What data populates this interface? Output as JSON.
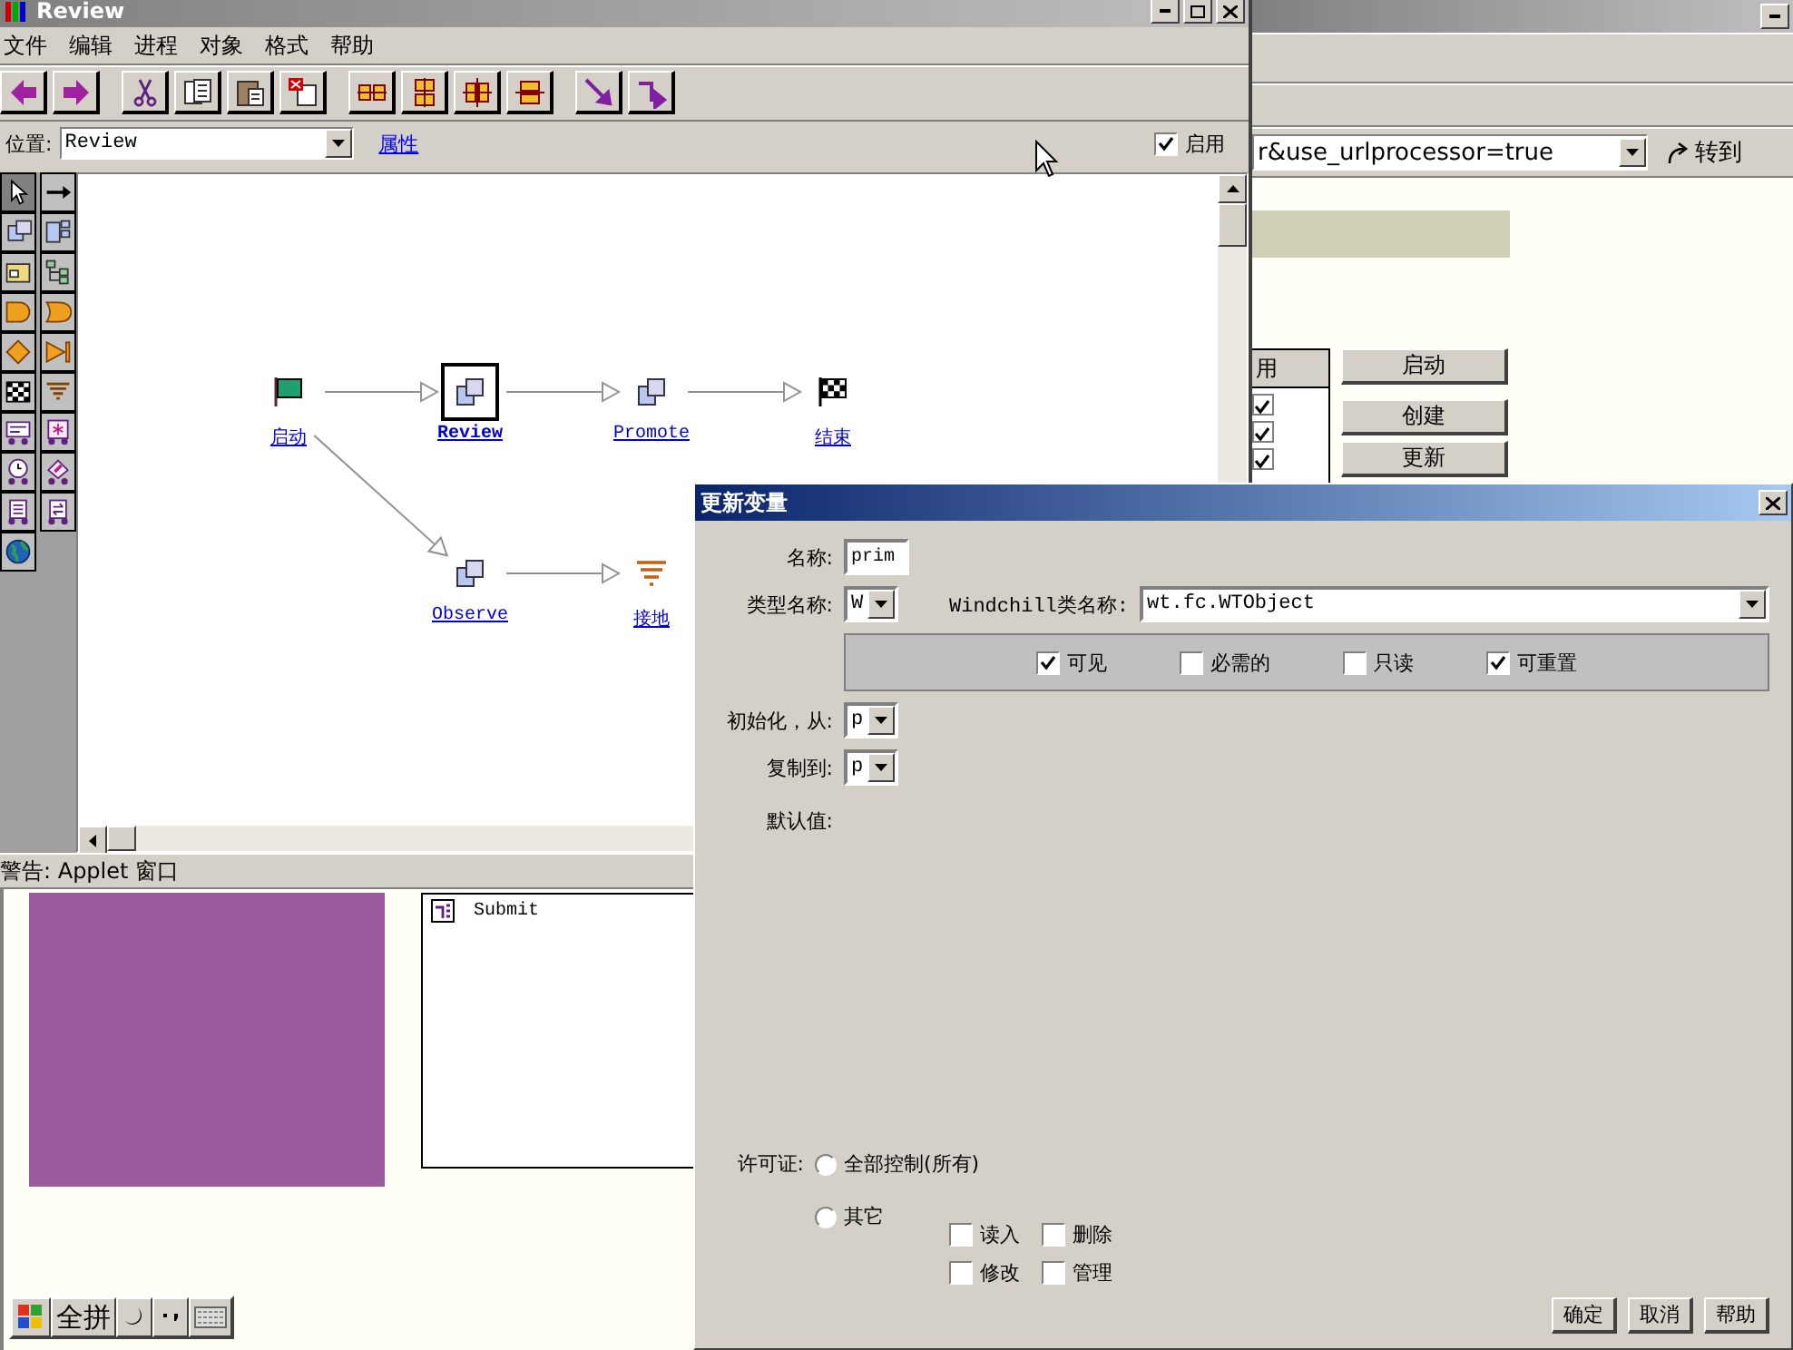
{
  "browser_window": {
    "address": "r&use_urlprocessor=true",
    "go_button": "转到",
    "table_header": "用",
    "table_rows": [
      {
        "checked": true
      },
      {
        "checked": true
      },
      {
        "checked": true
      }
    ],
    "buttons": [
      "启动",
      "创建",
      "更新"
    ]
  },
  "editor_window": {
    "title": "Review",
    "menu": [
      "文件",
      "编辑",
      "进程",
      "对象",
      "格式",
      "帮助"
    ],
    "location_label": "位置:",
    "location_value": "Review",
    "properties_link": "属性",
    "enabled_label": "启用",
    "enabled_checked": true,
    "palette": [
      {
        "selected": true
      },
      {
        "selected": false
      },
      {
        "selected": false
      },
      {
        "selected": false
      },
      {
        "selected": false
      },
      {
        "selected": false
      },
      {
        "selected": false
      },
      {
        "selected": false
      },
      {
        "selected": false
      },
      {
        "selected": false
      },
      {
        "selected": false
      },
      {
        "selected": false
      },
      {
        "selected": false
      },
      {
        "selected": false
      },
      {
        "selected": false
      },
      {
        "selected": false
      },
      {
        "selected": false
      },
      {
        "selected": false
      },
      {
        "selected": false
      }
    ],
    "nodes": [
      {
        "kind": "start",
        "label": "启动",
        "selected": false
      },
      {
        "kind": "activity",
        "label": "Review",
        "selected": true
      },
      {
        "kind": "activity",
        "label": "Promote",
        "selected": false
      },
      {
        "kind": "end",
        "label": "结束",
        "selected": false
      },
      {
        "kind": "activity",
        "label": "Observe",
        "selected": false
      },
      {
        "kind": "ground",
        "label": "接地",
        "selected": false
      }
    ]
  },
  "applet_window": {
    "warning": "警告: Applet 窗口",
    "list_items": [
      "Submit"
    ],
    "ime_mode": "全拼"
  },
  "dialog": {
    "title": "更新变量",
    "name_label": "名称:",
    "name_value": "prim",
    "type_label": "类型名称:",
    "type_value": "W",
    "class_label": "Windchill类名称:",
    "class_value": "wt.fc.WTObject",
    "flags": [
      {
        "label": "可见",
        "checked": true
      },
      {
        "label": "必需的",
        "checked": false
      },
      {
        "label": "只读",
        "checked": false
      },
      {
        "label": "可重置",
        "checked": true
      }
    ],
    "init_label": "初始化，从:",
    "init_value": "p",
    "copy_label": "复制到:",
    "copy_value": "p",
    "default_label": "默认值:",
    "license_label": "许可证:",
    "license_options": [
      {
        "label": "全部控制(所有)",
        "selected": false
      },
      {
        "label": "其它",
        "selected": false
      }
    ],
    "permissions": [
      {
        "label": "读入",
        "checked": false
      },
      {
        "label": "删除",
        "checked": false
      },
      {
        "label": "修改",
        "checked": false
      },
      {
        "label": "管理",
        "checked": false
      }
    ],
    "buttons": [
      "确定",
      "取消",
      "帮助"
    ]
  }
}
